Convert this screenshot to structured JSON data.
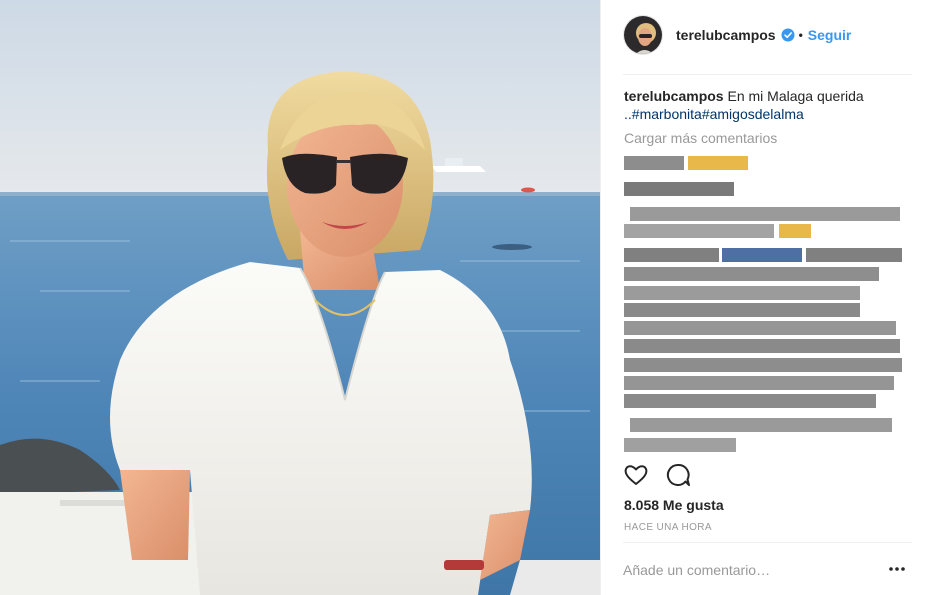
{
  "post": {
    "username": "terelubcampos",
    "dot": "•",
    "follow_label": "Seguir",
    "caption": {
      "username": "terelubcampos",
      "text": "En mi Malaga querida",
      "hashtags": "..#marbonita#amigosdelalma"
    },
    "load_more": "Cargar más comentarios",
    "likes": "8.058 Me gusta",
    "time": "HACE UNA HORA",
    "add_comment_placeholder": "Añade un comentario…"
  },
  "icons": {
    "verified": "verified-badge-icon",
    "like": "heart-icon",
    "comment": "speech-bubble-icon",
    "more": "more-options-icon"
  },
  "colors": {
    "accent": "#3897f0",
    "hashtag": "#003569",
    "muted": "#999999",
    "text": "#262626"
  }
}
